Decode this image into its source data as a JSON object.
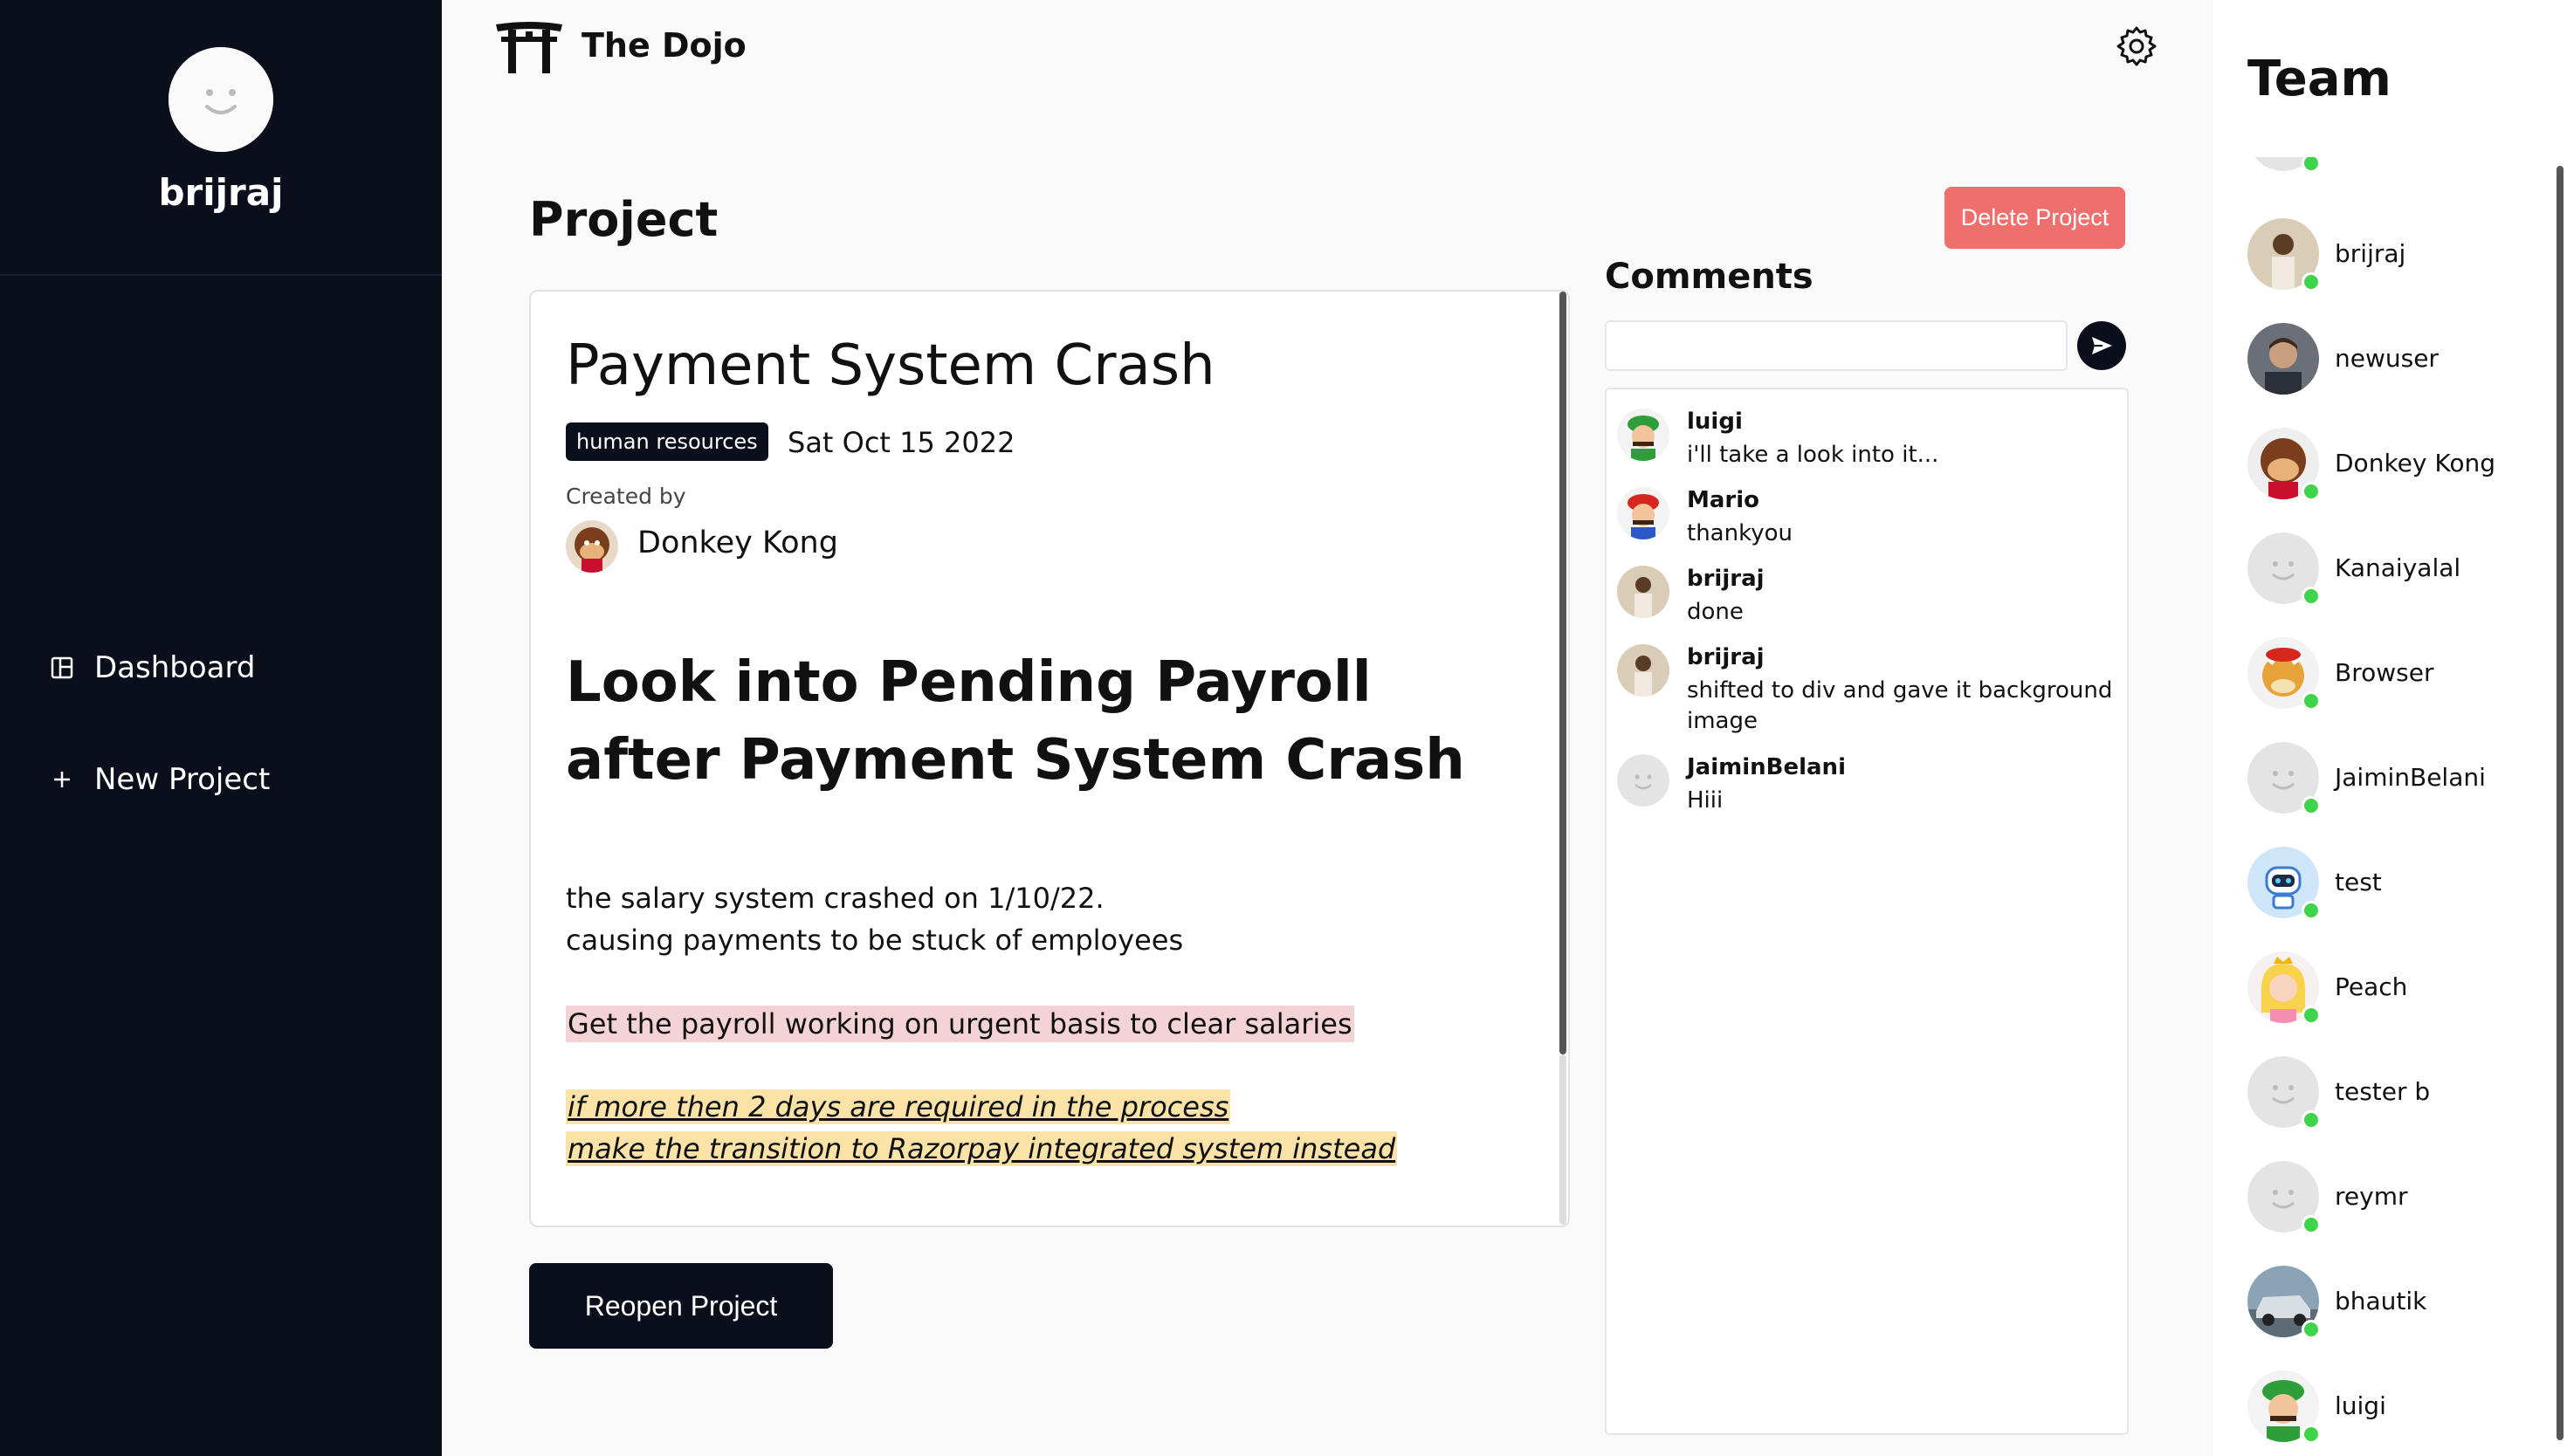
{
  "sidebar": {
    "user_name": "brijraj",
    "items": [
      {
        "label": "Dashboard",
        "icon": "dashboard-icon"
      },
      {
        "label": "New Project",
        "icon": "plus-icon"
      }
    ]
  },
  "header": {
    "brand": "The Dojo",
    "logo_icon": "torii-gate-icon",
    "settings_icon": "gear-icon"
  },
  "project": {
    "heading": "Project",
    "delete_label": "Delete Project",
    "title": "Payment System Crash",
    "tag": "human resources",
    "date": "Sat Oct 15 2022",
    "created_by_label": "Created by",
    "creator": "Donkey Kong",
    "detail_heading": "Look into Pending Payroll after Payment System Crash",
    "detail_line1": "the salary system crashed on 1/10/22.",
    "detail_line2": "causing payments to be stuck of employees",
    "detail_highlight": "Get the payroll working on urgent basis to clear salaries",
    "note_line1": "if more then 2 days are required in the process",
    "note_line2": "make the transition to Razorpay integrated system instead",
    "reopen_label": "Reopen Project"
  },
  "comments": {
    "heading": "Comments",
    "input_value": "",
    "send_icon": "send-icon",
    "items": [
      {
        "author": "luigi",
        "text": "i'll take a look into it...",
        "avatar": "luigi"
      },
      {
        "author": "Mario",
        "text": "thankyou",
        "avatar": "mario"
      },
      {
        "author": "brijraj",
        "text": "done",
        "avatar": "photo"
      },
      {
        "author": "brijraj",
        "text": "shifted to div and gave it background image",
        "avatar": "photo"
      },
      {
        "author": "JaiminBelani",
        "text": "Hiii",
        "avatar": "default"
      }
    ]
  },
  "team": {
    "heading": "Team",
    "members": [
      {
        "name": "brijraj",
        "avatar": "photo",
        "online": true
      },
      {
        "name": "newuser",
        "avatar": "man",
        "online": false
      },
      {
        "name": "Donkey Kong",
        "avatar": "donkeykong",
        "online": true
      },
      {
        "name": "Kanaiyalal",
        "avatar": "default",
        "online": true
      },
      {
        "name": "Browser",
        "avatar": "bowser",
        "online": true
      },
      {
        "name": "JaiminBelani",
        "avatar": "default",
        "online": true
      },
      {
        "name": "test",
        "avatar": "robot",
        "online": true
      },
      {
        "name": "Peach",
        "avatar": "peach",
        "online": true
      },
      {
        "name": "tester b",
        "avatar": "default",
        "online": true
      },
      {
        "name": "reymr",
        "avatar": "default",
        "online": true
      },
      {
        "name": "bhautik",
        "avatar": "car",
        "online": true
      },
      {
        "name": "luigi",
        "avatar": "luigi",
        "online": true
      }
    ]
  },
  "colors": {
    "sidebar_bg": "#0b0f1c",
    "delete_button": "#ef6f6c",
    "online_dot": "#3ed34a",
    "highlight_red": "#f3d3d3",
    "highlight_yellow": "#fbe3a7"
  }
}
